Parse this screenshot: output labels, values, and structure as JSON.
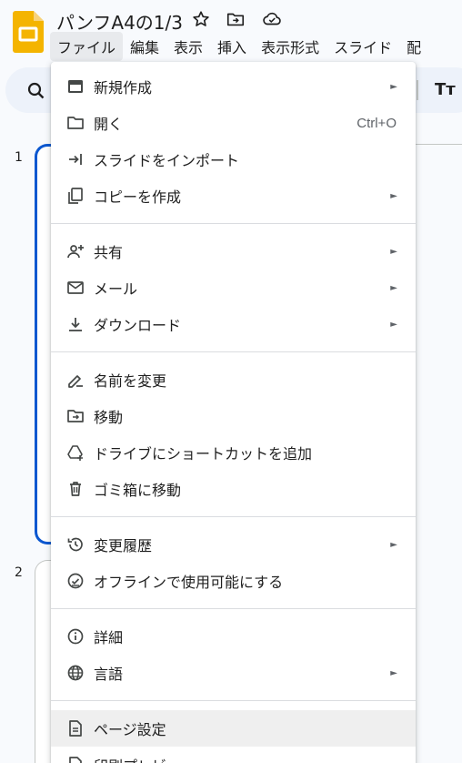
{
  "header": {
    "title": "パンフA4の1/3",
    "icons": [
      "star-icon",
      "move-to-folder-icon",
      "cloud-saved-icon"
    ]
  },
  "menubar": {
    "items": [
      "ファイル",
      "編集",
      "表示",
      "挿入",
      "表示形式",
      "スライド",
      "配"
    ]
  },
  "toolbar": {
    "format_text_glyph": "Tт"
  },
  "filmstrip": {
    "slide_numbers": [
      "1",
      "2"
    ]
  },
  "file_menu": {
    "items": [
      {
        "label": "新規作成",
        "icon": "new-slide-icon",
        "submenu": true
      },
      {
        "label": "開く",
        "icon": "folder-open-icon",
        "shortcut": "Ctrl+O"
      },
      {
        "label": "スライドをインポート",
        "icon": "import-icon"
      },
      {
        "label": "コピーを作成",
        "icon": "copy-icon",
        "submenu": true
      },
      {
        "label": "共有",
        "icon": "person-add-icon",
        "submenu": true
      },
      {
        "label": "メール",
        "icon": "mail-icon",
        "submenu": true
      },
      {
        "label": "ダウンロード",
        "icon": "download-icon",
        "submenu": true
      },
      {
        "label": "名前を変更",
        "icon": "rename-icon"
      },
      {
        "label": "移動",
        "icon": "move-folder-icon"
      },
      {
        "label": "ドライブにショートカットを追加",
        "icon": "drive-shortcut-icon"
      },
      {
        "label": "ゴミ箱に移動",
        "icon": "trash-icon"
      },
      {
        "label": "変更履歴",
        "icon": "history-icon",
        "submenu": true
      },
      {
        "label": "オフラインで使用可能にする",
        "icon": "offline-icon"
      },
      {
        "label": "詳細",
        "icon": "info-icon"
      },
      {
        "label": "言語",
        "icon": "globe-icon",
        "submenu": true
      },
      {
        "label": "ページ設定",
        "icon": "page-setup-icon"
      },
      {
        "label": "印刷プレビュー",
        "icon": "print-preview-icon"
      }
    ],
    "arrow_glyph": "►"
  }
}
